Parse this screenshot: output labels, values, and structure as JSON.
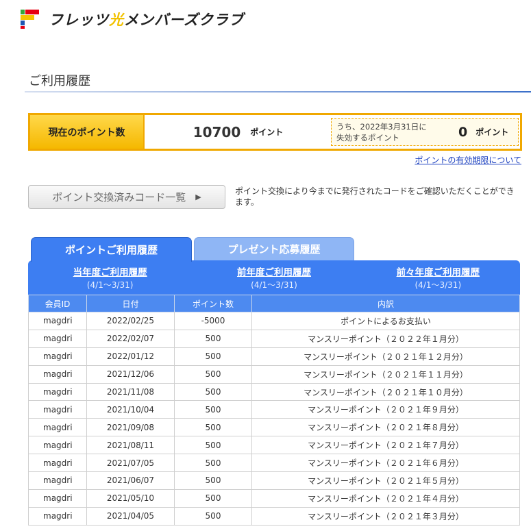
{
  "header": {
    "logo_text_prefix": "フレッツ",
    "logo_text_hikari": "光",
    "logo_text_suffix": "メンバーズクラブ"
  },
  "page": {
    "title": "ご利用履歴"
  },
  "points": {
    "label": "現在のポイント数",
    "value": "10700",
    "unit": "ポイント",
    "expire_text_line1": "うち、2022年3月31日に",
    "expire_text_line2": "失効するポイント",
    "expire_value": "0",
    "expire_unit": "ポイント",
    "expiry_link": "ポイントの有効期限について"
  },
  "code_list": {
    "button_label": "ポイント交換済みコード一覧",
    "description": "ポイント交換により今までに発行されたコードをご確認いただくことができます。"
  },
  "tabs": [
    {
      "label": "ポイントご利用履歴",
      "active": true
    },
    {
      "label": "プレゼント応募履歴",
      "active": false
    }
  ],
  "periods": [
    {
      "label": "当年度ご利用履歴",
      "range": "(4/1～3/31)"
    },
    {
      "label": "前年度ご利用履歴",
      "range": "(4/1～3/31)"
    },
    {
      "label": "前々年度ご利用履歴",
      "range": "(4/1～3/31)"
    }
  ],
  "table": {
    "headers": [
      "会員ID",
      "日付",
      "ポイント数",
      "内訳"
    ],
    "rows": [
      [
        "magdri",
        "2022/02/25",
        "-5000",
        "ポイントによるお支払い"
      ],
      [
        "magdri",
        "2022/02/07",
        "500",
        "マンスリーポイント（２０２２年１月分）"
      ],
      [
        "magdri",
        "2022/01/12",
        "500",
        "マンスリーポイント（２０２１年１２月分）"
      ],
      [
        "magdri",
        "2021/12/06",
        "500",
        "マンスリーポイント（２０２１年１１月分）"
      ],
      [
        "magdri",
        "2021/11/08",
        "500",
        "マンスリーポイント（２０２１年１０月分）"
      ],
      [
        "magdri",
        "2021/10/04",
        "500",
        "マンスリーポイント（２０２１年９月分）"
      ],
      [
        "magdri",
        "2021/09/08",
        "500",
        "マンスリーポイント（２０２１年８月分）"
      ],
      [
        "magdri",
        "2021/08/11",
        "500",
        "マンスリーポイント（２０２１年７月分）"
      ],
      [
        "magdri",
        "2021/07/05",
        "500",
        "マンスリーポイント（２０２１年６月分）"
      ],
      [
        "magdri",
        "2021/06/07",
        "500",
        "マンスリーポイント（２０２１年５月分）"
      ],
      [
        "magdri",
        "2021/05/10",
        "500",
        "マンスリーポイント（２０２１年４月分）"
      ],
      [
        "magdri",
        "2021/04/05",
        "500",
        "マンスリーポイント（２０２１年３月分）"
      ]
    ]
  }
}
